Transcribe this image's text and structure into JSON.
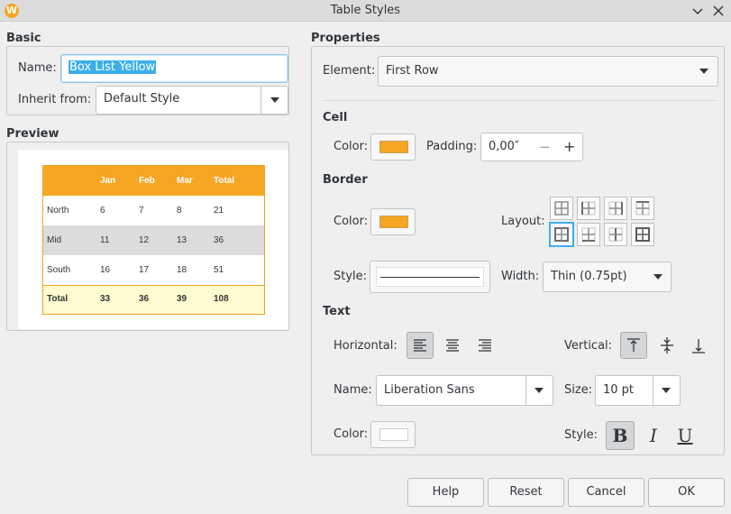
{
  "window": {
    "title": "Table Styles",
    "app_icon_letter": "W"
  },
  "basic": {
    "title": "Basic",
    "name_label": "Name:",
    "name_value": "Box List Yellow",
    "inherit_label": "Inherit from:",
    "inherit_value": "Default Style"
  },
  "preview": {
    "title": "Preview",
    "header": [
      "",
      "Jan",
      "Feb",
      "Mar",
      "Total"
    ],
    "rows": [
      [
        "North",
        "6",
        "7",
        "8",
        "21"
      ],
      [
        "Mid",
        "11",
        "12",
        "13",
        "36"
      ],
      [
        "South",
        "16",
        "17",
        "18",
        "51"
      ],
      [
        "Total",
        "33",
        "36",
        "39",
        "108"
      ]
    ]
  },
  "properties": {
    "title": "Properties",
    "element_label": "Element:",
    "element_value": "First Row",
    "cell": {
      "title": "Cell",
      "color_label": "Color:",
      "color": "#f5a623",
      "padding_label": "Padding:",
      "padding_value": "0,00″",
      "minus": "−",
      "plus": "+"
    },
    "border": {
      "title": "Border",
      "color_label": "Color:",
      "color": "#f5a623",
      "layout_label": "Layout:",
      "style_label": "Style:",
      "width_label": "Width:",
      "width_value": "Thin (0.75pt)"
    },
    "text": {
      "title": "Text",
      "horizontal_label": "Horizontal:",
      "vertical_label": "Vertical:",
      "name_label": "Name:",
      "font_name": "Liberation Sans",
      "size_label": "Size:",
      "size_value": "10 pt",
      "color_label": "Color:",
      "color": "#ffffff",
      "style_label": "Style:",
      "bold": "B",
      "italic": "I",
      "underline": "U"
    }
  },
  "buttons": {
    "help": "Help",
    "reset": "Reset",
    "cancel": "Cancel",
    "ok": "OK"
  },
  "colors": {
    "header_bg": "#f5a623",
    "alt_row_bg": "#dcdcdc",
    "total_row_bg": "#fffbd0",
    "selection_blue": "#3daee9"
  }
}
